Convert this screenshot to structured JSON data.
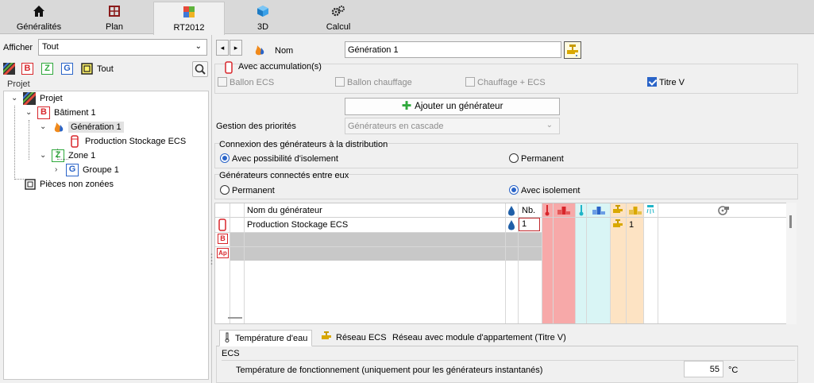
{
  "top_tabs": [
    {
      "label": "Généralités",
      "icon": "home-icon"
    },
    {
      "label": "Plan",
      "icon": "plan-icon"
    },
    {
      "label": "RT2012",
      "icon": "rt2012-icon"
    },
    {
      "label": "3D",
      "icon": "cube-icon"
    },
    {
      "label": "Calcul",
      "icon": "gears-icon"
    }
  ],
  "left": {
    "afficher_label": "Afficher",
    "afficher_value": "Tout",
    "filters": {
      "b": "B",
      "z": "Z",
      "g": "G",
      "tout": "Tout"
    },
    "tree_header": "Projet",
    "tree": {
      "projet": "Projet",
      "batiment": "Bâtiment 1",
      "generation": "Génération 1",
      "production": "Production Stockage ECS",
      "zone": "Zone 1",
      "groupe": "Groupe 1",
      "pieces": "Pièces non zonées"
    }
  },
  "right": {
    "nom_label": "Nom",
    "nom_value": "Génération 1",
    "accumulation_title": "Avec accumulation(s)",
    "checkboxes": {
      "ballon_ecs": "Ballon ECS",
      "ballon_chauffage": "Ballon chauffage",
      "chauffage_ecs": "Chauffage + ECS",
      "titre_v": "Titre V"
    },
    "add_button": "Ajouter un générateur",
    "priorites_label": "Gestion des priorités",
    "priorites_value": "Générateurs en cascade",
    "connexion_title": "Connexion des générateurs à la distribution",
    "connexion_options": {
      "isolement": "Avec possibilité d'isolement",
      "permanent": "Permanent"
    },
    "connectes_title": "Générateurs connectés entre eux",
    "connectes_options": {
      "permanent": "Permanent",
      "isolement": "Avec isolement"
    },
    "grid": {
      "col_nom": "Nom du générateur",
      "col_nb": "Nb.",
      "row1_name": "Production Stockage ECS",
      "row1_nb": "1",
      "row1_tap": "1",
      "row2_badge": "B",
      "row3_badge": "Ap"
    },
    "bottom_tabs": {
      "temperature": "Température d'eau",
      "reseau": "Réseau ECS",
      "reseau_titrev": "Réseau avec module d'appartement (Titre V)"
    },
    "ecs_title": "ECS",
    "temp_label": "Température de fonctionnement (uniquement pour les générateurs instantanés)",
    "temp_value": "55",
    "temp_unit": "°C"
  },
  "colors": {
    "pink": "#f7a9a9",
    "cyan": "#d9f5f5",
    "peach": "#fde3c3",
    "gray_row": "#c8c8c8",
    "accent": "#2a64c8"
  }
}
